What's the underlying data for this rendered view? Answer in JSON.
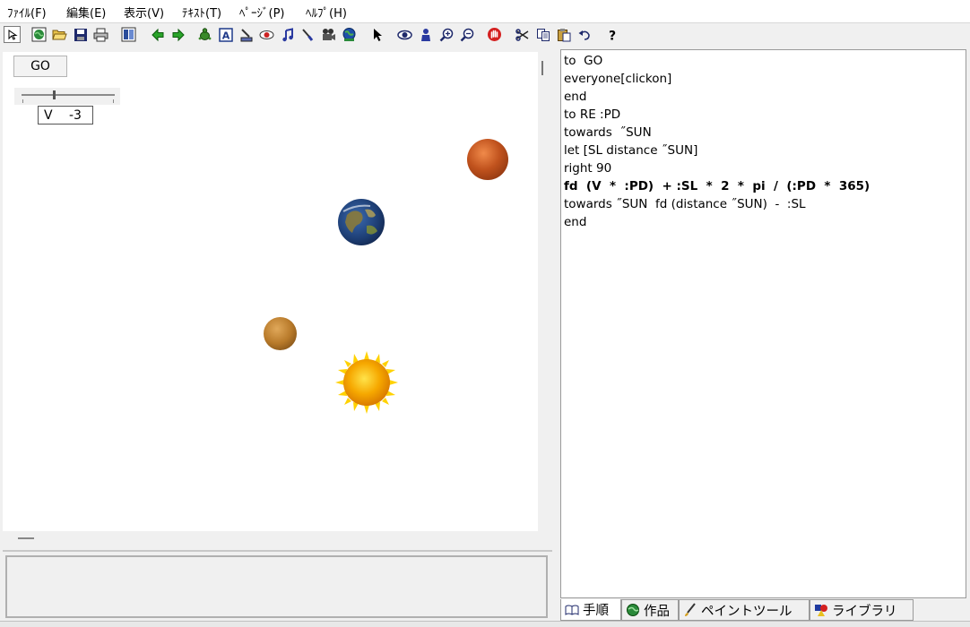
{
  "menu": [
    "ﾌｧｲﾙ(F)",
    "編集(E)",
    "表示(V)",
    "ﾃｷｽﾄ(T)",
    "ﾍﾟｰｼﾞ(P)",
    "ﾍﾙﾌﾟ(H)"
  ],
  "toolbar_icons": [
    "select-arrow-icon",
    "globe-icon",
    "open-folder-icon",
    "save-icon",
    "print-icon",
    "book-icon",
    "back-arrow-icon",
    "forward-arrow-icon",
    "turtle-icon",
    "text-box-icon",
    "stamp-icon",
    "eye-shape-icon",
    "music-note-icon",
    "brush-icon",
    "movie-camera-icon",
    "earth-ball-icon",
    "pointer-icon",
    "eye-icon",
    "person-icon",
    "zoom-in-icon",
    "zoom-out-icon",
    "stop-hand-icon",
    "scissors-icon",
    "copy-icon",
    "paste-icon",
    "undo-icon",
    "help-icon"
  ],
  "canvas": {
    "go_button": "GO",
    "slider": {
      "value": -3,
      "min": -10,
      "max": 10
    },
    "variable": {
      "name": "V",
      "value": "-3"
    }
  },
  "planets": [
    {
      "name": "mars",
      "color": "#c0521d"
    },
    {
      "name": "earth",
      "color": "#1d3d73"
    },
    {
      "name": "venus",
      "color": "#b87a2a"
    },
    {
      "name": "sun",
      "color": "#f6a800"
    }
  ],
  "editor": {
    "lines": [
      {
        "text": "to  GO",
        "bold": false
      },
      {
        "text": "everyone[clickon]",
        "bold": false
      },
      {
        "text": "end",
        "bold": false
      },
      {
        "text": "to RE :PD",
        "bold": false
      },
      {
        "text": "towards  ˝SUN",
        "bold": false
      },
      {
        "text": "let [SL distance ˝SUN]",
        "bold": false
      },
      {
        "text": "right 90",
        "bold": false
      },
      {
        "text": "fd  (V  *  :PD)  + :SL  *  2  *  pi  /  (:PD  *  365)",
        "bold": true
      },
      {
        "text": "towards ˝SUN  fd (distance ˝SUN)  -  :SL",
        "bold": false
      },
      {
        "text": "end",
        "bold": false
      }
    ]
  },
  "tabs": [
    {
      "label": "手順",
      "icon": "open-book-icon",
      "active": true
    },
    {
      "label": "作品",
      "icon": "globe-icon",
      "active": false
    },
    {
      "label": "ペイントツール",
      "icon": "paint-brush-icon",
      "active": false
    },
    {
      "label": "ライブラリ",
      "icon": "shapes-library-icon",
      "active": false
    }
  ]
}
